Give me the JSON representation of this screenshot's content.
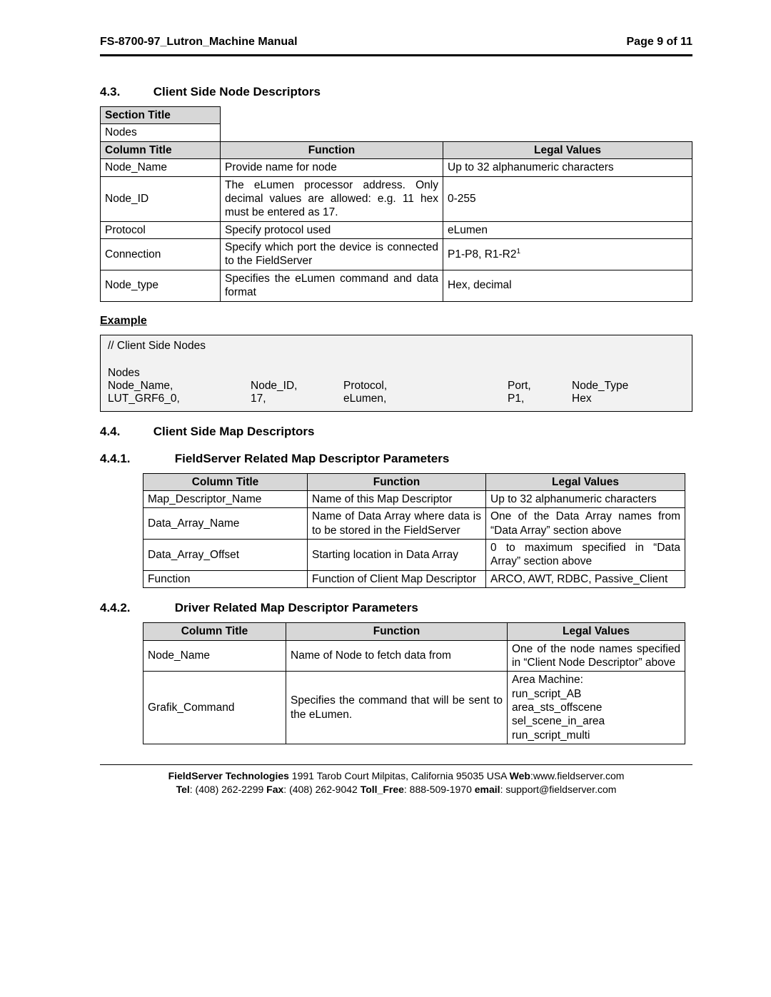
{
  "header": {
    "left": "FS-8700-97_Lutron_Machine Manual",
    "right": "Page 9 of 11"
  },
  "section43": {
    "num": "4.3.",
    "title": "Client Side Node Descriptors",
    "sectionTitleHeader": "Section Title",
    "sectionTitleValue": "Nodes",
    "headers": {
      "col": "Column Title",
      "func": "Function",
      "legal": "Legal Values"
    },
    "rows": [
      {
        "col": "Node_Name",
        "func": "Provide name for node",
        "legal": "Up to 32 alphanumeric characters"
      },
      {
        "col": "Node_ID",
        "func": "The eLumen processor address. Only decimal values are allowed: e.g. 11 hex must be entered as 17.",
        "legal": "0-255"
      },
      {
        "col": "Protocol",
        "func": "Specify protocol used",
        "legal": "eLumen"
      },
      {
        "col": "Connection",
        "func": "Specify which port the device is connected to the FieldServer",
        "legal": "P1-P8, R1-R2",
        "sup": "1"
      },
      {
        "col": "Node_type",
        "func": "Specifies the eLumen command and data format",
        "legal": "Hex, decimal"
      }
    ]
  },
  "example": {
    "label": "Example",
    "comment": "//    Client Side Nodes",
    "section": "Nodes",
    "hdr": [
      "Node_Name,",
      "Node_ID,",
      "Protocol,",
      "Port,",
      "Node_Type"
    ],
    "row": [
      "LUT_GRF6_0,",
      "17,",
      "eLumen,",
      "P1,",
      "Hex"
    ]
  },
  "section44": {
    "num": "4.4.",
    "title": "Client Side Map Descriptors"
  },
  "section441": {
    "num": "4.4.1.",
    "title": "FieldServer Related Map Descriptor Parameters",
    "headers": {
      "col": "Column Title",
      "func": "Function",
      "legal": "Legal Values"
    },
    "rows": [
      {
        "col": "Map_Descriptor_Name",
        "func_parts": [
          "Name",
          "of",
          "this",
          "Map",
          "Descriptor"
        ],
        "legal_parts": [
          "Up",
          "to",
          "32",
          "alphanumeric",
          "characters"
        ]
      },
      {
        "col": "Data_Array_Name",
        "func_parts": [
          "Name",
          "of",
          "Data",
          "Array",
          "where",
          "data",
          "is",
          "to",
          "be",
          "stored",
          "in",
          "the",
          "FieldServer"
        ],
        "legal_parts": [
          "One",
          "of",
          "the",
          "Data",
          "Array",
          "names",
          "from",
          "“Data",
          "Array”",
          "section above"
        ]
      },
      {
        "col": "Data_Array_Offset",
        "func": "Starting location in Data Array",
        "legal": "0 to maximum specified in “Data Array” section above"
      },
      {
        "col": "Function",
        "func": "Function of Client Map Descriptor",
        "legal_parts": [
          "ARCO,",
          "AWT,",
          "RDBC,",
          "Passive_Client"
        ]
      }
    ]
  },
  "section442": {
    "num": "4.4.2.",
    "title": "Driver Related Map Descriptor Parameters",
    "headers": {
      "col": "Column Title",
      "func": "Function",
      "legal": "Legal Values"
    },
    "rows": [
      {
        "col": "Node_Name",
        "func": "Name of Node to fetch data from",
        "legal": "One of the node names specified in “Client Node Descriptor” above"
      },
      {
        "col": "Grafik_Command",
        "func": "Specifies the command that will be sent to the eLumen.",
        "legal": "Area Machine:\nrun_script_AB\narea_sts_offscene\nsel_scene_in_area\nrun_script_multi"
      }
    ]
  },
  "footer": {
    "line1a": "FieldServer Technologies",
    "line1b": " 1991 Tarob Court Milpitas, California 95035 USA  ",
    "line1c": "Web",
    "line1d": ":www.fieldserver.com",
    "line2a": "Tel",
    "line2b": ": (408) 262-2299  ",
    "line2c": "Fax",
    "line2d": ": (408) 262-9042  ",
    "line2e": "Toll_Free",
    "line2f": ": 888-509-1970  ",
    "line2g": "email",
    "line2h": ": support@fieldserver.com"
  }
}
